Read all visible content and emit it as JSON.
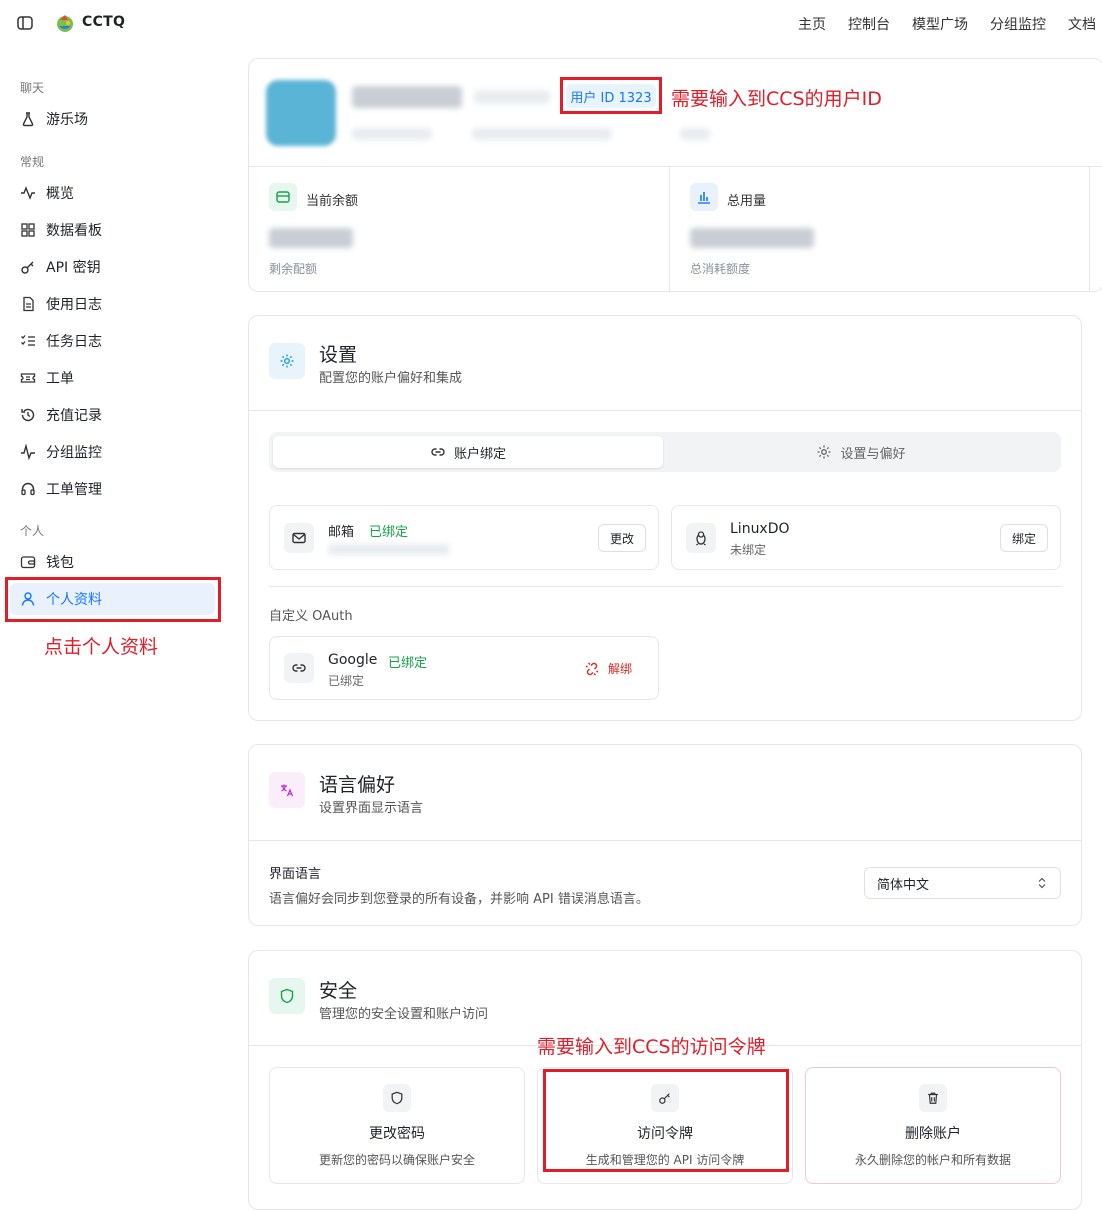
{
  "app": {
    "name": "CCTQ"
  },
  "nav": [
    "主页",
    "控制台",
    "模型广场",
    "分组监控",
    "文档"
  ],
  "sidebar": {
    "sections": [
      {
        "title": "聊天",
        "items": [
          {
            "label": "游乐场",
            "icon": "flask-icon"
          }
        ]
      },
      {
        "title": "常规",
        "items": [
          {
            "label": "概览",
            "icon": "activity-icon"
          },
          {
            "label": "数据看板",
            "icon": "grid-icon"
          },
          {
            "label": "API 密钥",
            "icon": "key-icon"
          },
          {
            "label": "使用日志",
            "icon": "file-text-icon"
          },
          {
            "label": "任务日志",
            "icon": "list-check-icon"
          },
          {
            "label": "工单",
            "icon": "ticket-icon"
          },
          {
            "label": "充值记录",
            "icon": "history-icon"
          },
          {
            "label": "分组监控",
            "icon": "pulse-icon"
          },
          {
            "label": "工单管理",
            "icon": "headset-icon"
          }
        ]
      },
      {
        "title": "个人",
        "items": [
          {
            "label": "钱包",
            "icon": "wallet-icon"
          },
          {
            "label": "个人资料",
            "icon": "user-icon",
            "active": true
          }
        ]
      }
    ]
  },
  "annotations": {
    "click_profile": "点击个人资料",
    "user_id_note": "需要输入到CCS的用户ID",
    "token_note": "需要输入到CCS的访问令牌"
  },
  "profile": {
    "user_id_badge": "用户 ID 1323",
    "balance_label": "当前余额",
    "balance_sub": "剩余配额",
    "usage_label": "总用量",
    "usage_sub": "总消耗额度"
  },
  "settings": {
    "title": "设置",
    "subtitle": "配置您的账户偏好和集成",
    "tabs": [
      "账户绑定",
      "设置与偏好"
    ],
    "email": {
      "label": "邮箱",
      "status": "已绑定",
      "button": "更改"
    },
    "linuxdo": {
      "label": "LinuxDO",
      "status": "未绑定",
      "button": "绑定"
    },
    "oauth_title": "自定义 OAuth",
    "google": {
      "label": "Google",
      "status_badge": "已绑定",
      "status": "已绑定",
      "button": "解绑"
    }
  },
  "language": {
    "title": "语言偏好",
    "subtitle": "设置界面显示语言",
    "field_label": "界面语言",
    "field_desc": "语言偏好会同步到您登录的所有设备，并影响 API 错误消息语言。",
    "selected": "简体中文"
  },
  "security": {
    "title": "安全",
    "subtitle": "管理您的安全设置和账户访问",
    "cards": [
      {
        "title": "更改密码",
        "desc": "更新您的密码以确保账户安全",
        "icon": "shield-icon"
      },
      {
        "title": "访问令牌",
        "desc": "生成和管理您的 API 访问令牌",
        "icon": "key-icon"
      },
      {
        "title": "删除账户",
        "desc": "永久删除您的帐户和所有数据",
        "icon": "trash-icon"
      }
    ]
  },
  "colors": {
    "accent": "#1677ff",
    "annotation": "#e11d2a",
    "success": "#16a34a",
    "danger": "#dc2626"
  }
}
